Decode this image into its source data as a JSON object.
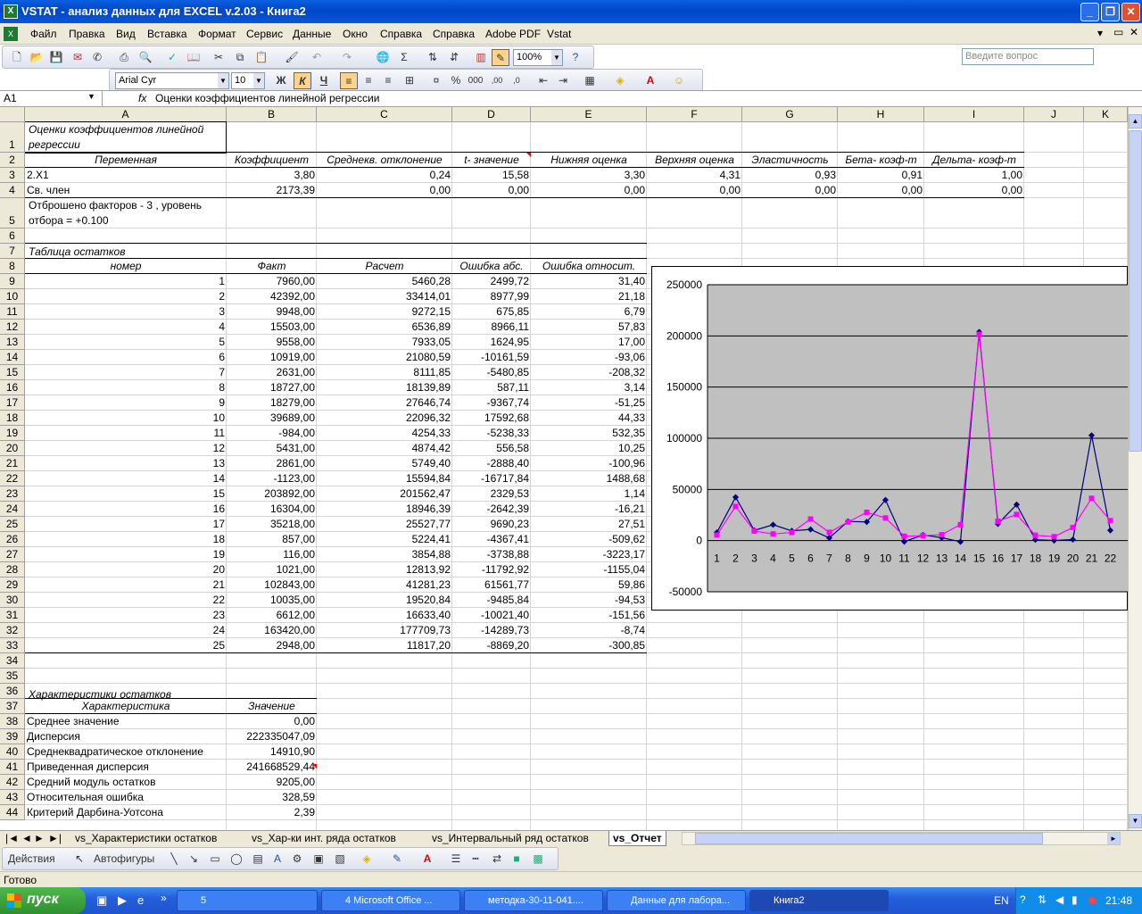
{
  "window": {
    "title": "VSTAT - анализ данных для EXCEL v.2.03 - Книга2"
  },
  "menu": [
    "Файл",
    "Правка",
    "Вид",
    "Вставка",
    "Формат",
    "Сервис",
    "Данные",
    "Окно",
    "Справка",
    "Справка",
    "Adobe PDF",
    "Vstat"
  ],
  "help_placeholder": "Введите вопрос",
  "toolbar": {
    "zoom": "100%",
    "font": "Arial Cyr",
    "size": "10",
    "bold": "Ж",
    "italic": "К",
    "underline": "Ч"
  },
  "formula_bar": {
    "cell": "A1",
    "fx": "fx",
    "value": "Оценки коэффициентов линейной регрессии"
  },
  "columns": [
    "A",
    "B",
    "C",
    "D",
    "E",
    "F",
    "G",
    "H",
    "I",
    "J",
    "K"
  ],
  "rows": [
    "1",
    "2",
    "3",
    "4",
    "5",
    "6",
    "7",
    "8",
    "9",
    "10",
    "11",
    "12",
    "13",
    "14",
    "15",
    "16",
    "17",
    "18",
    "19",
    "20",
    "21",
    "22",
    "23",
    "24",
    "25",
    "26",
    "27",
    "28",
    "29",
    "30",
    "31",
    "32",
    "33",
    "34",
    "35",
    "36",
    "37",
    "38",
    "39",
    "40",
    "41",
    "42",
    "43",
    "44"
  ],
  "sheet": {
    "a1_line1": "Оценки коэффициентов линейной",
    "a1_line2": "регрессии",
    "coef_header": [
      "Переменная",
      "Коэффициент",
      "Среднекв. отклонение",
      "t- значение",
      "Нижняя оценка",
      "Верхняя оценка",
      "Эластичность",
      "Бета- коэф-т",
      "Дельта- коэф-т"
    ],
    "coef_rows": [
      [
        "2.X1",
        "3,80",
        "0,24",
        "15,58",
        "3,30",
        "4,31",
        "0,93",
        "0,91",
        "1,00"
      ],
      [
        "Св. член",
        "2173,39",
        "0,00",
        "0,00",
        "0,00",
        "0,00",
        "0,00",
        "0,00",
        "0,00"
      ]
    ],
    "a5_line1": "Отброшено факторов - 3 , уровень",
    "a5_line2": "отбора = +0.100",
    "resid_title": "Таблица остатков",
    "resid_header": [
      "номер",
      "Факт",
      "Расчет",
      "Ошибка абс.",
      "Ошибка относит."
    ],
    "resid_rows": [
      [
        "1",
        "7960,00",
        "5460,28",
        "2499,72",
        "31,40"
      ],
      [
        "2",
        "42392,00",
        "33414,01",
        "8977,99",
        "21,18"
      ],
      [
        "3",
        "9948,00",
        "9272,15",
        "675,85",
        "6,79"
      ],
      [
        "4",
        "15503,00",
        "6536,89",
        "8966,11",
        "57,83"
      ],
      [
        "5",
        "9558,00",
        "7933,05",
        "1624,95",
        "17,00"
      ],
      [
        "6",
        "10919,00",
        "21080,59",
        "-10161,59",
        "-93,06"
      ],
      [
        "7",
        "2631,00",
        "8111,85",
        "-5480,85",
        "-208,32"
      ],
      [
        "8",
        "18727,00",
        "18139,89",
        "587,11",
        "3,14"
      ],
      [
        "9",
        "18279,00",
        "27646,74",
        "-9367,74",
        "-51,25"
      ],
      [
        "10",
        "39689,00",
        "22096,32",
        "17592,68",
        "44,33"
      ],
      [
        "11",
        "-984,00",
        "4254,33",
        "-5238,33",
        "532,35"
      ],
      [
        "12",
        "5431,00",
        "4874,42",
        "556,58",
        "10,25"
      ],
      [
        "13",
        "2861,00",
        "5749,40",
        "-2888,40",
        "-100,96"
      ],
      [
        "14",
        "-1123,00",
        "15594,84",
        "-16717,84",
        "1488,68"
      ],
      [
        "15",
        "203892,00",
        "201562,47",
        "2329,53",
        "1,14"
      ],
      [
        "16",
        "16304,00",
        "18946,39",
        "-2642,39",
        "-16,21"
      ],
      [
        "17",
        "35218,00",
        "25527,77",
        "9690,23",
        "27,51"
      ],
      [
        "18",
        "857,00",
        "5224,41",
        "-4367,41",
        "-509,62"
      ],
      [
        "19",
        "116,00",
        "3854,88",
        "-3738,88",
        "-3223,17"
      ],
      [
        "20",
        "1021,00",
        "12813,92",
        "-11792,92",
        "-1155,04"
      ],
      [
        "21",
        "102843,00",
        "41281,23",
        "61561,77",
        "59,86"
      ],
      [
        "22",
        "10035,00",
        "19520,84",
        "-9485,84",
        "-94,53"
      ],
      [
        "23",
        "6612,00",
        "16633,40",
        "-10021,40",
        "-151,56"
      ],
      [
        "24",
        "163420,00",
        "177709,73",
        "-14289,73",
        "-8,74"
      ],
      [
        "25",
        "2948,00",
        "11817,20",
        "-8869,20",
        "-300,85"
      ]
    ],
    "char_title": "Характеристики остатков",
    "char_header": [
      "Характеристика",
      "Значение"
    ],
    "char_rows": [
      [
        "Среднее значение",
        "0,00"
      ],
      [
        "Дисперсия",
        "222335047,09"
      ],
      [
        "Среднеквадратическое отклонение",
        "14910,90"
      ],
      [
        "Приведенная дисперсия",
        "241668529,44"
      ],
      [
        "Средний модуль остатков",
        "9205,00"
      ],
      [
        "Относительная ошибка",
        "328,59"
      ],
      [
        "Критерий Дарбина-Уотсона",
        "2,39"
      ]
    ]
  },
  "chart_data": {
    "type": "line",
    "x": [
      1,
      2,
      3,
      4,
      5,
      6,
      7,
      8,
      9,
      10,
      11,
      12,
      13,
      14,
      15,
      16,
      17,
      18,
      19,
      20,
      21,
      22
    ],
    "series": [
      {
        "values": [
          7960,
          42392,
          9948,
          15503,
          9558,
          10919,
          2631,
          18727,
          18279,
          39689,
          -984,
          5431,
          2861,
          -1123,
          203892,
          16304,
          35218,
          857,
          116,
          1021,
          102843,
          10035
        ],
        "color": "#000080"
      },
      {
        "values": [
          5460.28,
          33414.01,
          9272.15,
          6536.89,
          7933.05,
          21080.59,
          8111.85,
          18139.89,
          27646.74,
          22096.32,
          4254.33,
          4874.42,
          5749.4,
          15594.84,
          201562.47,
          18946.39,
          25527.77,
          5224.41,
          3854.88,
          12813.92,
          41281.23,
          19520.84
        ],
        "color": "#ff00ff"
      }
    ],
    "ylim": [
      -50000,
      250000
    ],
    "yticks": [
      "250000",
      "200000",
      "150000",
      "100000",
      "50000",
      "0",
      "-50000"
    ],
    "plot_bg": "#c0c0c0",
    "grid": true
  },
  "tabs": [
    "vs_Характеристики остатков",
    "vs_Хар-ки инт. ряда остатков",
    "vs_Интервальный ряд остатков",
    "vs_Отчет"
  ],
  "drawbar": {
    "actions": "Действия",
    "autoshapes": "Автофигуры"
  },
  "status": "Готово",
  "taskbar": {
    "start": "пуск",
    "items": [
      "5",
      "4 Microsoft Office ...",
      "методка-30-11-041....",
      "Данные для лабора...",
      "Книга2"
    ],
    "lang": "EN",
    "time": "21:48"
  }
}
